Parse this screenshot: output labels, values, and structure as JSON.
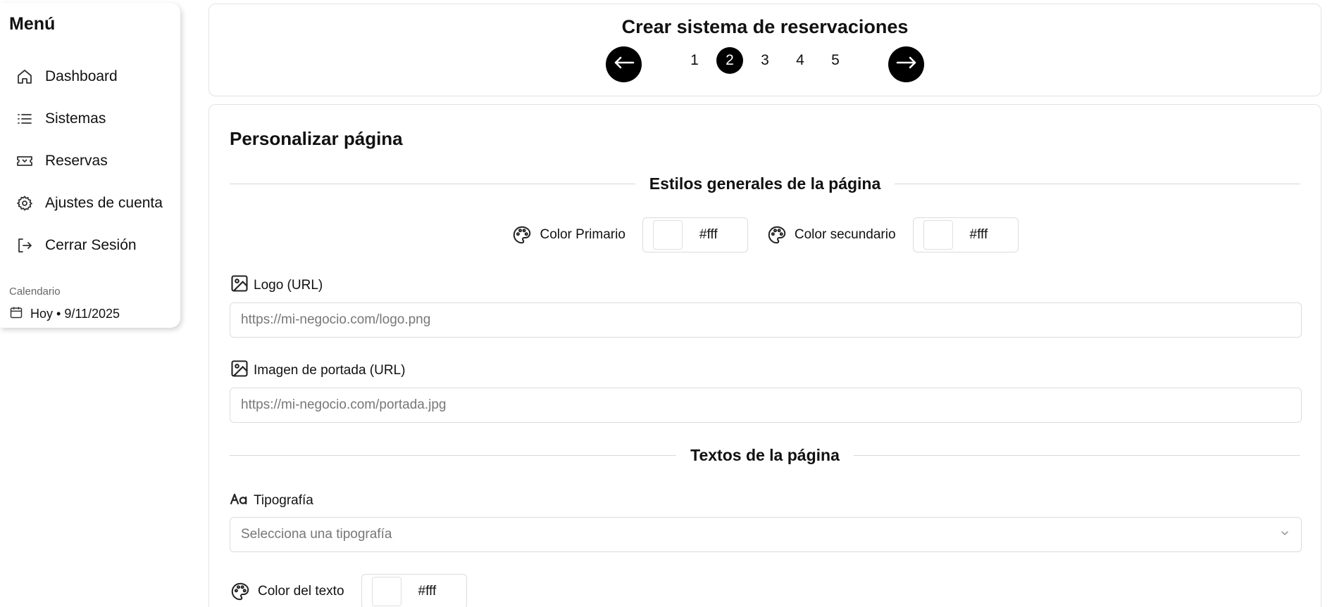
{
  "sidebar": {
    "title": "Menú",
    "items": [
      {
        "label": "Dashboard",
        "icon": "home-icon"
      },
      {
        "label": "Sistemas",
        "icon": "list-icon"
      },
      {
        "label": "Reservas",
        "icon": "ticket-icon"
      },
      {
        "label": "Ajustes de cuenta",
        "icon": "gear-icon"
      },
      {
        "label": "Cerrar Sesión",
        "icon": "logout-icon"
      }
    ],
    "calendar_label": "Calendario",
    "calendar_today": "Hoy • 9/11/2025"
  },
  "wizard": {
    "title": "Crear sistema de reservaciones",
    "prev_icon": "arrow-left-icon",
    "next_icon": "arrow-right-icon",
    "steps": [
      "1",
      "2",
      "3",
      "4",
      "5"
    ],
    "active_step": "2"
  },
  "main": {
    "title": "Personalizar página",
    "general_styles_heading": "Estilos generales de la página",
    "primary_color": {
      "label": "Color Primario",
      "value": "#fff"
    },
    "secondary_color": {
      "label": "Color secundario",
      "value": "#fff"
    },
    "logo": {
      "label": "Logo (URL)",
      "placeholder": "https://mi-negocio.com/logo.png"
    },
    "cover": {
      "label": "Imagen de portada (URL)",
      "placeholder": "https://mi-negocio.com/portada.jpg"
    },
    "texts_heading": "Textos de la página",
    "typography": {
      "label": "Tipografía",
      "placeholder": "Selecciona una tipografía"
    },
    "text_color": {
      "label": "Color del texto",
      "value": "#fff"
    }
  },
  "colors": {
    "accent": "#000000",
    "border": "#dcdcdc",
    "muted_text": "#777777"
  }
}
